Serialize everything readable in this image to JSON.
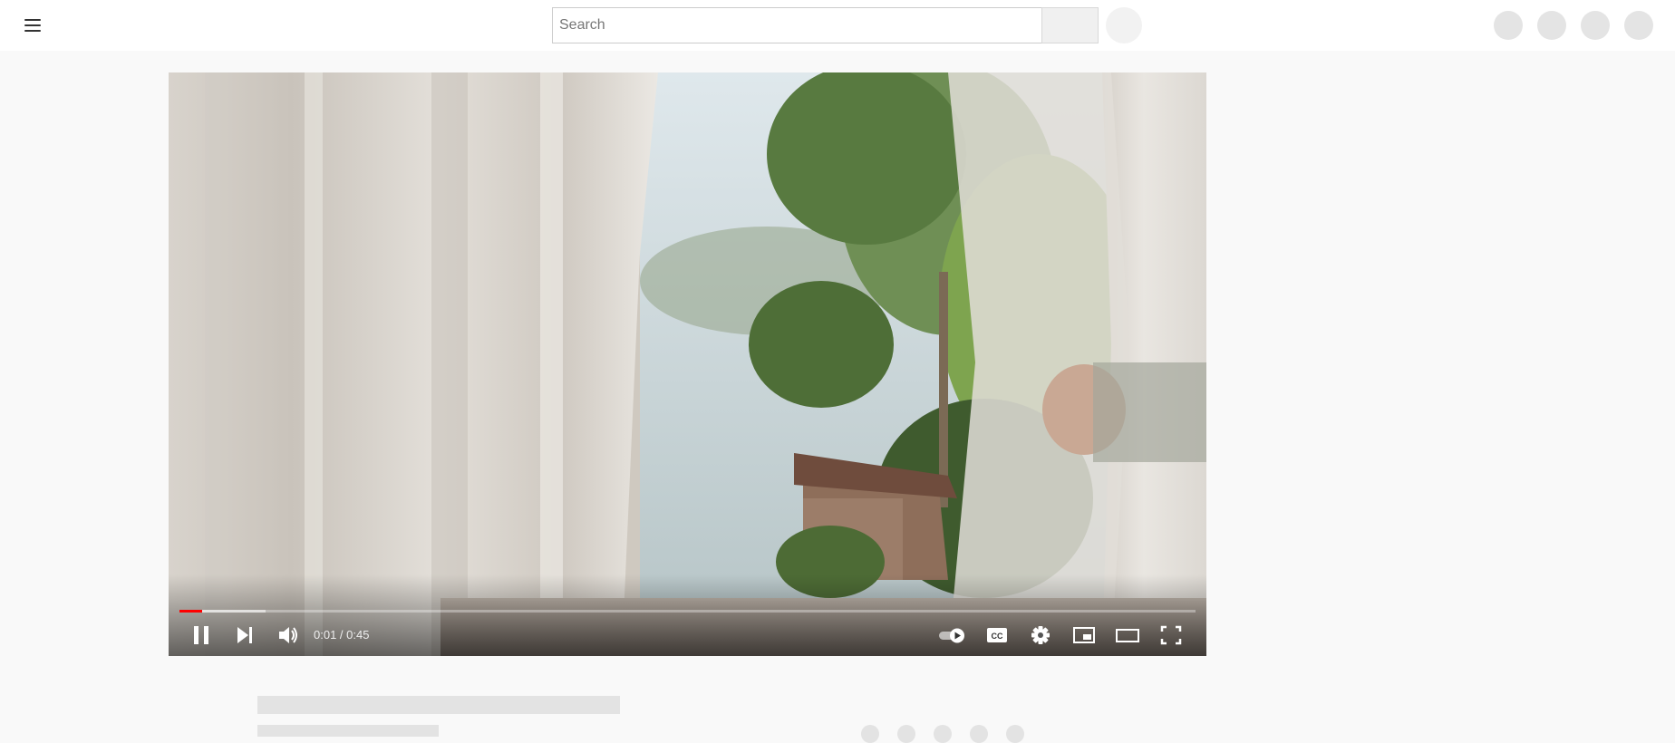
{
  "search": {
    "placeholder": "Search",
    "value": ""
  },
  "player": {
    "time_current": "0:01",
    "time_separator": " / ",
    "time_total": "0:45",
    "progress_played_fraction": 0.022,
    "progress_buffered_fraction": 0.085,
    "autoplay_on": true,
    "accent_color": "#ff0000"
  },
  "icons": {
    "menu": "hamburger-menu-icon",
    "play_state": "pause-icon",
    "next": "next-icon",
    "volume": "volume-icon",
    "autoplay": "autoplay-toggle-icon",
    "captions": "cc-icon",
    "settings": "gear-icon",
    "miniplayer": "miniplayer-icon",
    "theater": "theater-mode-icon",
    "fullscreen": "fullscreen-icon"
  }
}
